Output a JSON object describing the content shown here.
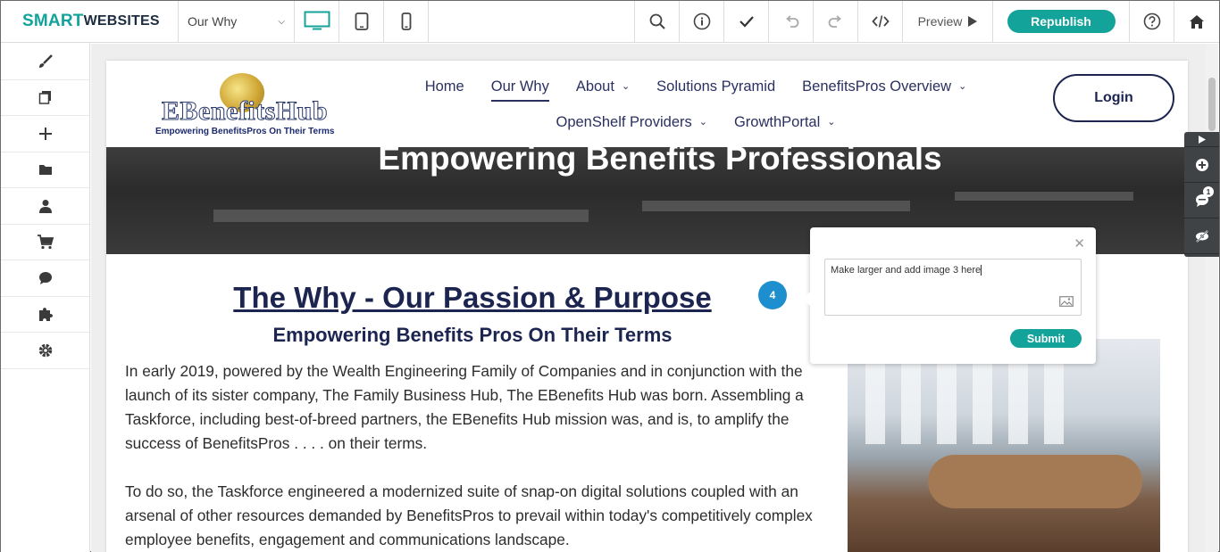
{
  "toolbar": {
    "brand_smart": "SMART",
    "brand_websites": "WEBSITES",
    "page_select": "Our Why",
    "preview_label": "Preview",
    "republish_label": "Republish"
  },
  "sidebar": {
    "items": [
      "brush-icon",
      "pages-icon",
      "add-icon",
      "folder-icon",
      "user-icon",
      "cart-icon",
      "chat-icon",
      "puzzle-icon",
      "settings-icon"
    ]
  },
  "site": {
    "logo_text": "EBenefitsHub",
    "logo_tagline": "Empowering BenefitsPros On Their Terms",
    "nav": {
      "row1": [
        "Home",
        "Our Why",
        "About",
        "Solutions Pyramid",
        "BenefitsPros Overview"
      ],
      "row2": [
        "OpenShelf Providers",
        "GrowthPortal"
      ]
    },
    "login_label": "Login",
    "hero_title": "Empowering Benefits Professionals",
    "heading": "The Why - Our Passion & Purpose",
    "subheading": "Empowering Benefits Pros On Their Terms",
    "paragraph1": "In early 2019, powered by the Wealth Engineering Family of Companies and in conjunction with the launch of its sister company, The Family Business Hub, The EBenefits Hub was born. Assembling a Taskforce, including best-of-breed partners, the EBenefits Hub mission was, and is, to amplify the success of BenefitsPros . . . . on their terms.",
    "paragraph2": "To do so, the Taskforce engineered a modernized suite of snap-on digital solutions coupled with an arsenal of other resources demanded by BenefitsPros to prevail within today's competitively complex employee benefits, engagement and communications landscape."
  },
  "comment": {
    "marker_number": "4",
    "text": "Make larger and add image 3 here",
    "submit_label": "Submit"
  },
  "right_panel": {
    "badge_count": "1"
  },
  "colors": {
    "accent": "#14a39a",
    "navy": "#1c2450",
    "marker_blue": "#1e8fce"
  }
}
